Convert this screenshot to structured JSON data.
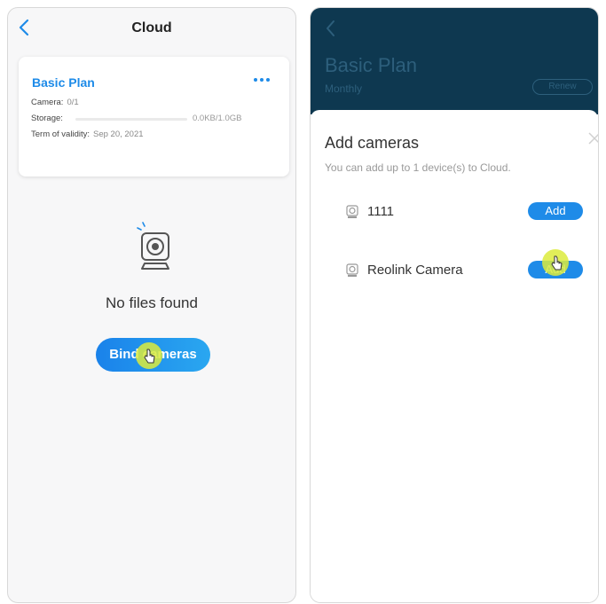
{
  "left_screen": {
    "header": {
      "title": "Cloud",
      "back_icon": "chevron-left-icon"
    },
    "plan_card": {
      "plan_name": "Basic Plan",
      "more_icon": "more-horizontal-icon",
      "camera_label": "Camera:",
      "camera_value": "0/1",
      "storage_label": "Storage:",
      "storage_value": "0.0KB/1.0GB",
      "storage_used_fraction": 0,
      "term_label": "Term of validity:",
      "term_value": "Sep 20, 2021"
    },
    "empty_state": {
      "icon": "camera-icon",
      "message": "No files found",
      "button_label": "Bind cameras"
    }
  },
  "right_screen": {
    "header": {
      "back_icon": "chevron-left-icon",
      "plan_title": "Basic Plan",
      "plan_subtitle": "Monthly",
      "renew_label": "Renew"
    },
    "sheet": {
      "title": "Add cameras",
      "subtitle": "You can add up to 1 device(s) to Cloud.",
      "close_icon": "close-icon",
      "cameras": [
        {
          "name": "1111",
          "button_label": "Add",
          "icon": "camera-icon"
        },
        {
          "name": "Reolink Camera",
          "button_label": "Add",
          "icon": "camera-icon"
        }
      ]
    }
  },
  "colors": {
    "accent": "#1e8be8",
    "header_dark": "#0e3850",
    "touch_indicator": "#dceb3c"
  }
}
